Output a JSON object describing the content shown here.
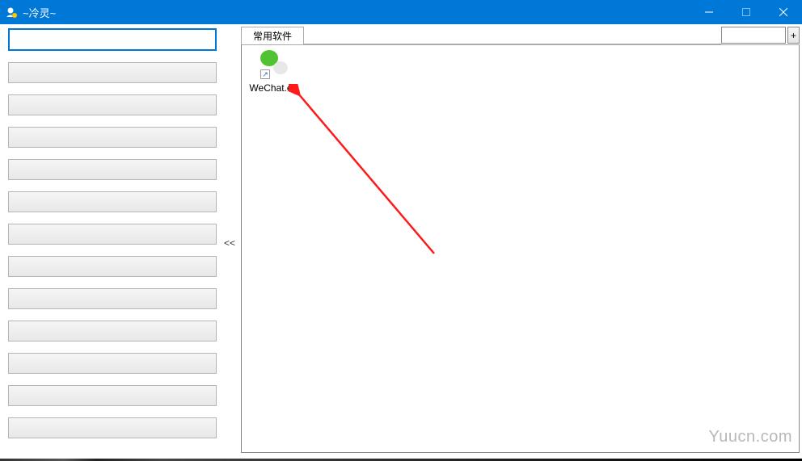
{
  "window": {
    "title": "~冷灵~"
  },
  "sidebar": {
    "items": [
      {
        "label": "",
        "selected": true
      },
      {
        "label": "",
        "selected": false
      },
      {
        "label": "",
        "selected": false
      },
      {
        "label": "",
        "selected": false
      },
      {
        "label": "",
        "selected": false
      },
      {
        "label": "",
        "selected": false
      },
      {
        "label": "",
        "selected": false
      },
      {
        "label": "",
        "selected": false
      },
      {
        "label": "",
        "selected": false
      },
      {
        "label": "",
        "selected": false
      },
      {
        "label": "",
        "selected": false
      },
      {
        "label": "",
        "selected": false
      },
      {
        "label": "",
        "selected": false
      }
    ]
  },
  "collapse_toggle": "<<",
  "tabs": {
    "active": "常用软件"
  },
  "search": {
    "value": "",
    "placeholder": ""
  },
  "plus_button": "+",
  "apps": [
    {
      "name": "WeChat.e...",
      "icon": "wechat"
    }
  ],
  "watermark": "Yuucn.com"
}
